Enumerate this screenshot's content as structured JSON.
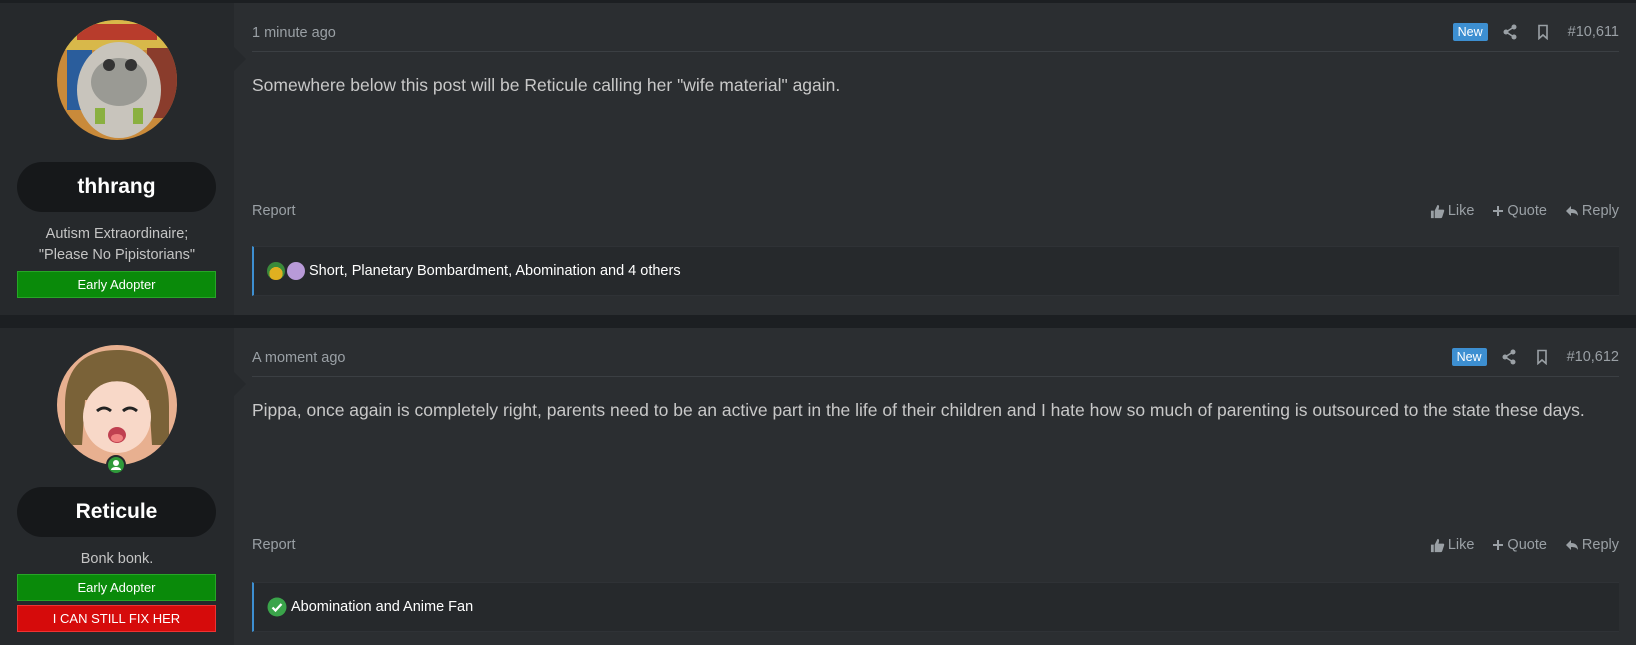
{
  "posts": [
    {
      "username": "thhrang",
      "user_title_line1": "Autism Extraordinaire;",
      "user_title_line2": "\"Please No Pipistorians\"",
      "banners": [
        "Early Adopter"
      ],
      "timestamp": "1 minute ago",
      "new_label": "New",
      "post_number": "#10,611",
      "content": "Somewhere below this post will be Reticule calling her \"wife material\" again.",
      "report_label": "Report",
      "like_label": "Like",
      "quote_label": "Quote",
      "reply_label": "Reply",
      "reactions_text": "Short, Planetary Bombardment, Abomination and 4 others"
    },
    {
      "username": "Reticule",
      "user_title_line1": "Bonk bonk.",
      "banners": [
        "Early Adopter",
        "I CAN STILL FIX HER"
      ],
      "timestamp": "A moment ago",
      "new_label": "New",
      "post_number": "#10,612",
      "content": "Pippa, once again is completely right, parents need to be an active part in the life of their children and I hate how so much of parenting is outsourced to the state these days.",
      "report_label": "Report",
      "like_label": "Like",
      "quote_label": "Quote",
      "reply_label": "Reply",
      "reactions_text": "Abomination and Anime Fan"
    }
  ],
  "icons": {
    "share": "share-icon",
    "bookmark": "bookmark-icon",
    "like": "thumbs-up-icon",
    "quote": "plus-icon",
    "reply": "reply-arrow-icon"
  },
  "colors": {
    "new_badge": "#3d8fd1",
    "banner_green": "#0a8a0a",
    "banner_red": "#d60b0b",
    "reaction_border": "#3d8fd1"
  }
}
